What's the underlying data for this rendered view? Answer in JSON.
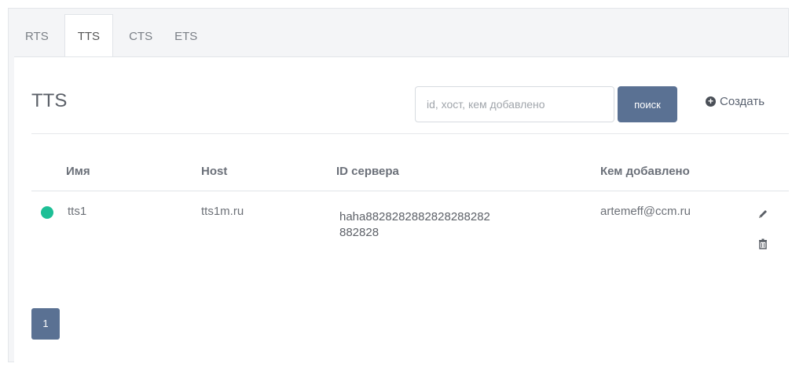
{
  "tabs": [
    {
      "label": "RTS",
      "active": false
    },
    {
      "label": "TTS",
      "active": true
    },
    {
      "label": "CTS",
      "active": false
    },
    {
      "label": "ETS",
      "active": false
    }
  ],
  "page": {
    "title": "TTS"
  },
  "search": {
    "placeholder": "id, хост, кем добавлено",
    "value": "",
    "button_label": "поиск"
  },
  "create": {
    "label": "Создать",
    "icon": "plus-circle-icon"
  },
  "table": {
    "headers": {
      "name": "Имя",
      "host": "Host",
      "server_id": "ID сервера",
      "added_by": "Кем добавлено"
    },
    "rows": [
      {
        "status": "online",
        "status_color": "#1dbf96",
        "name": "tts1",
        "host": "tts1m.ru",
        "server_id": "haha8828282882828288282882828",
        "added_by": "artemeff@ccm.ru",
        "actions": [
          "pencil-icon",
          "trash-icon"
        ]
      }
    ]
  },
  "pagination": {
    "pages": [
      "1"
    ],
    "current": "1"
  },
  "colors": {
    "accent": "#5a7193",
    "status_online": "#1dbf96"
  }
}
